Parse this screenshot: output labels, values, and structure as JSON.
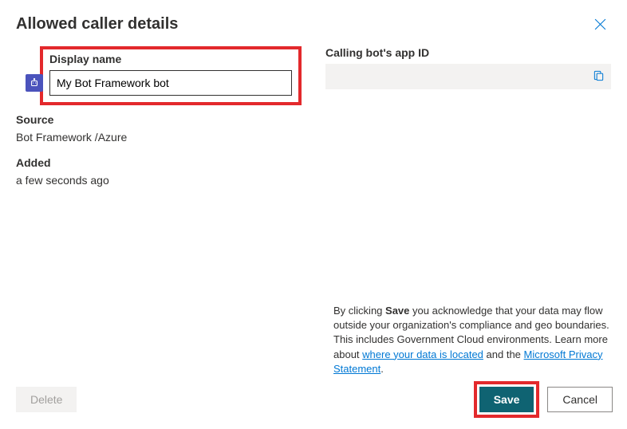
{
  "header": {
    "title": "Allowed caller details"
  },
  "form": {
    "displayName": {
      "label": "Display name",
      "value": "My Bot Framework bot"
    },
    "source": {
      "label": "Source",
      "value": "Bot Framework /Azure"
    },
    "added": {
      "label": "Added",
      "value": "a few seconds ago"
    },
    "appId": {
      "label": "Calling bot's app ID",
      "value": ""
    }
  },
  "disclaimer": {
    "prefix": "By clicking ",
    "bold": "Save",
    "part1": " you acknowledge that your data may flow outside your organization's compliance and geo boundaries. This includes Government Cloud environments. Learn more about ",
    "link1": "where your data is located",
    "part2": " and the ",
    "link2": "Microsoft Privacy Statement",
    "period": "."
  },
  "buttons": {
    "delete": "Delete",
    "save": "Save",
    "cancel": "Cancel"
  }
}
